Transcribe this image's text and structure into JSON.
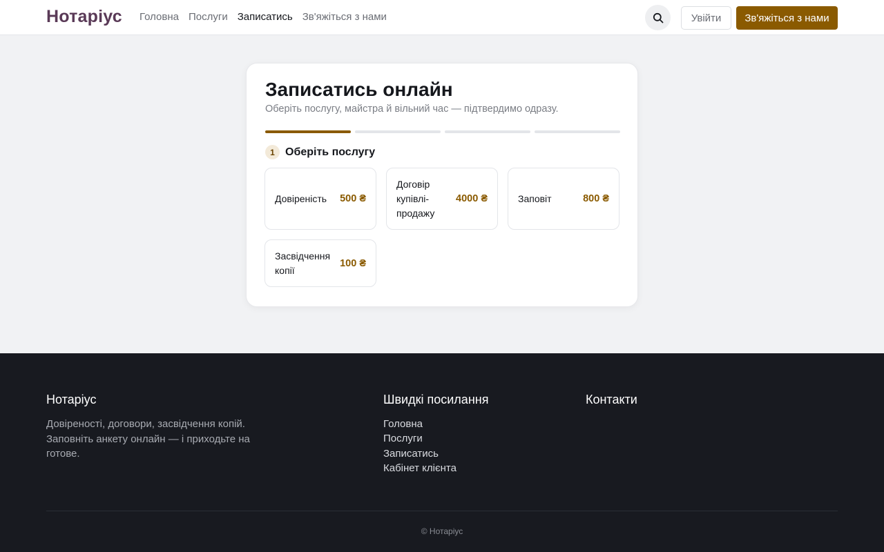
{
  "header": {
    "logo": "Нотаріус",
    "nav": [
      {
        "label": "Головна",
        "active": false
      },
      {
        "label": "Послуги",
        "active": false
      },
      {
        "label": "Записатись",
        "active": true
      },
      {
        "label": "Зв'яжіться з нами",
        "active": false
      }
    ],
    "search_icon": "search-icon",
    "login_label": "Увійти",
    "contact_label": "Зв'яжіться з нами"
  },
  "booking": {
    "title": "Записатись онлайн",
    "subtitle": "Оберіть послугу, майстра й вільний час — підтвердимо одразу.",
    "progress": {
      "total_steps": 4,
      "current_step": 1
    },
    "step_number": "1",
    "step_title": "Оберіть послугу",
    "services": [
      {
        "name": "Довіреність",
        "price": "500 ₴"
      },
      {
        "name": "Договір купівлі-продажу",
        "price": "4000 ₴"
      },
      {
        "name": "Заповіт",
        "price": "800 ₴"
      },
      {
        "name": "Засвідчення копії",
        "price": "100 ₴"
      }
    ]
  },
  "footer": {
    "brand": "Нотаріус",
    "description": "Довіреності, договори, засвідчення копій. Заповніть анкету онлайн — і приходьте на готове.",
    "links_heading": "Швидкі посилання",
    "links": [
      "Головна",
      "Послуги",
      "Записатись",
      "Кабінет клієнта"
    ],
    "contacts_heading": "Контакти",
    "copyright": "© Нотаріус"
  },
  "colors": {
    "accent": "#8a5a00",
    "logo": "#5a3a57",
    "footer_bg": "#181a20"
  }
}
